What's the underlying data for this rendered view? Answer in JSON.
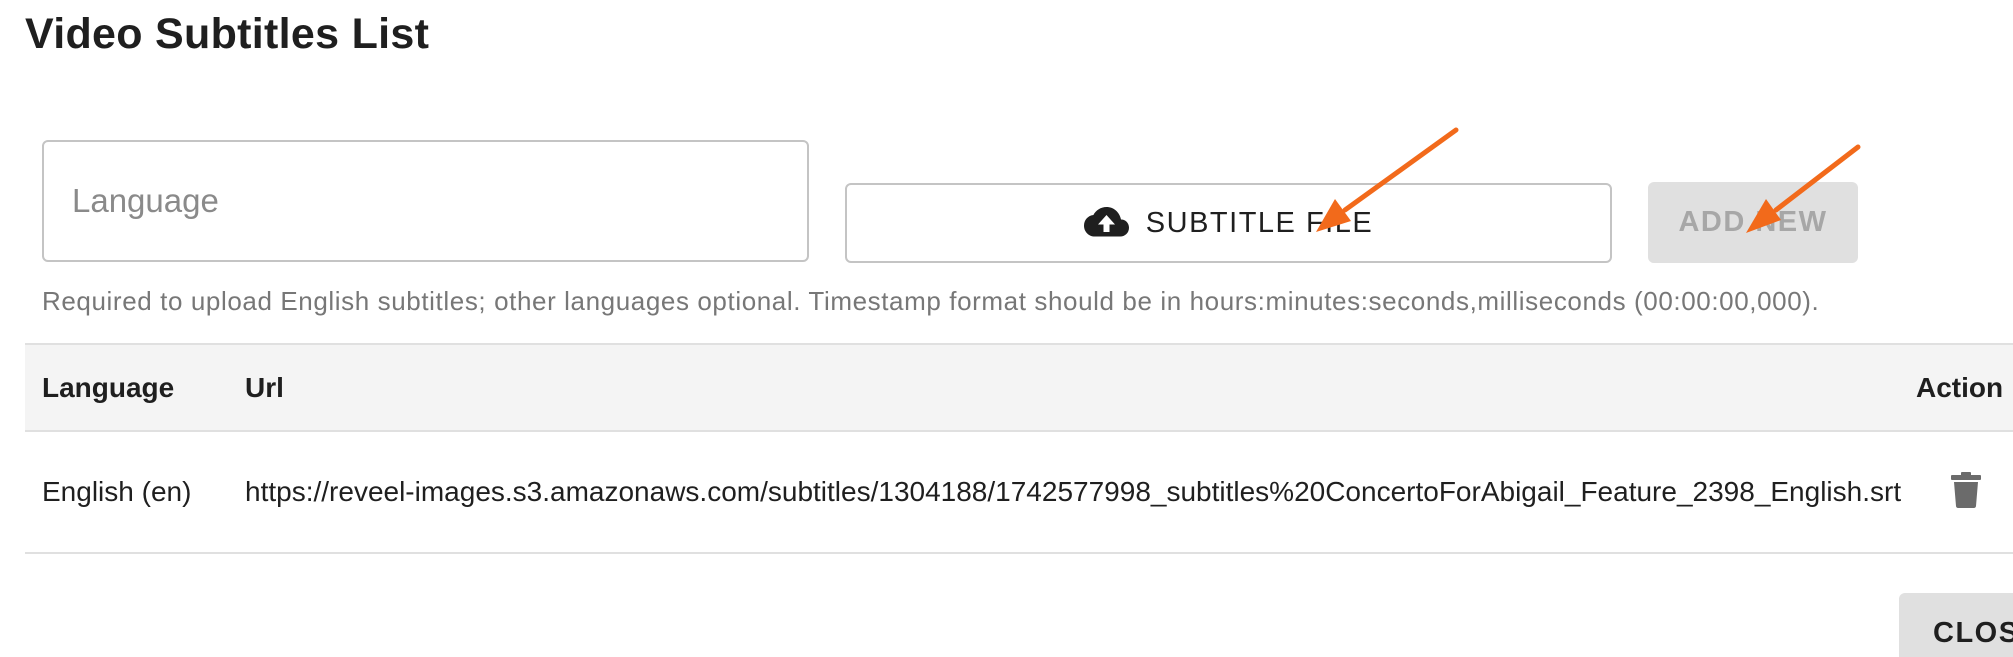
{
  "page_title": "Video Subtitles List",
  "form": {
    "language_placeholder": "Language",
    "language_value": "",
    "upload_label": "SUBTITLE FILE",
    "upload_icon": "cloud-upload-icon",
    "add_new_label": "ADD NEW",
    "helper_text": "Required to upload English subtitles; other languages optional. Timestamp format should be in hours:minutes:seconds,milliseconds (00:00:00,000)."
  },
  "table": {
    "headers": {
      "language": "Language",
      "url": "Url",
      "action": "Action"
    },
    "rows": [
      {
        "language": "English (en)",
        "url": "https://reveel-images.s3.amazonaws.com/subtitles/1304188/1742577998_subtitles%20ConcertoForAbigail_Feature_2398_English.srt",
        "action_icon": "trash-icon"
      }
    ]
  },
  "footer": {
    "close_label": "CLOSE"
  },
  "annotations": {
    "arrow_color": "#f26a1b"
  },
  "colors": {
    "button_disabled_bg": "#e0e0e0",
    "button_disabled_text": "#a7a7a7",
    "header_bg": "#f4f4f4",
    "border": "#c4c4c4"
  }
}
